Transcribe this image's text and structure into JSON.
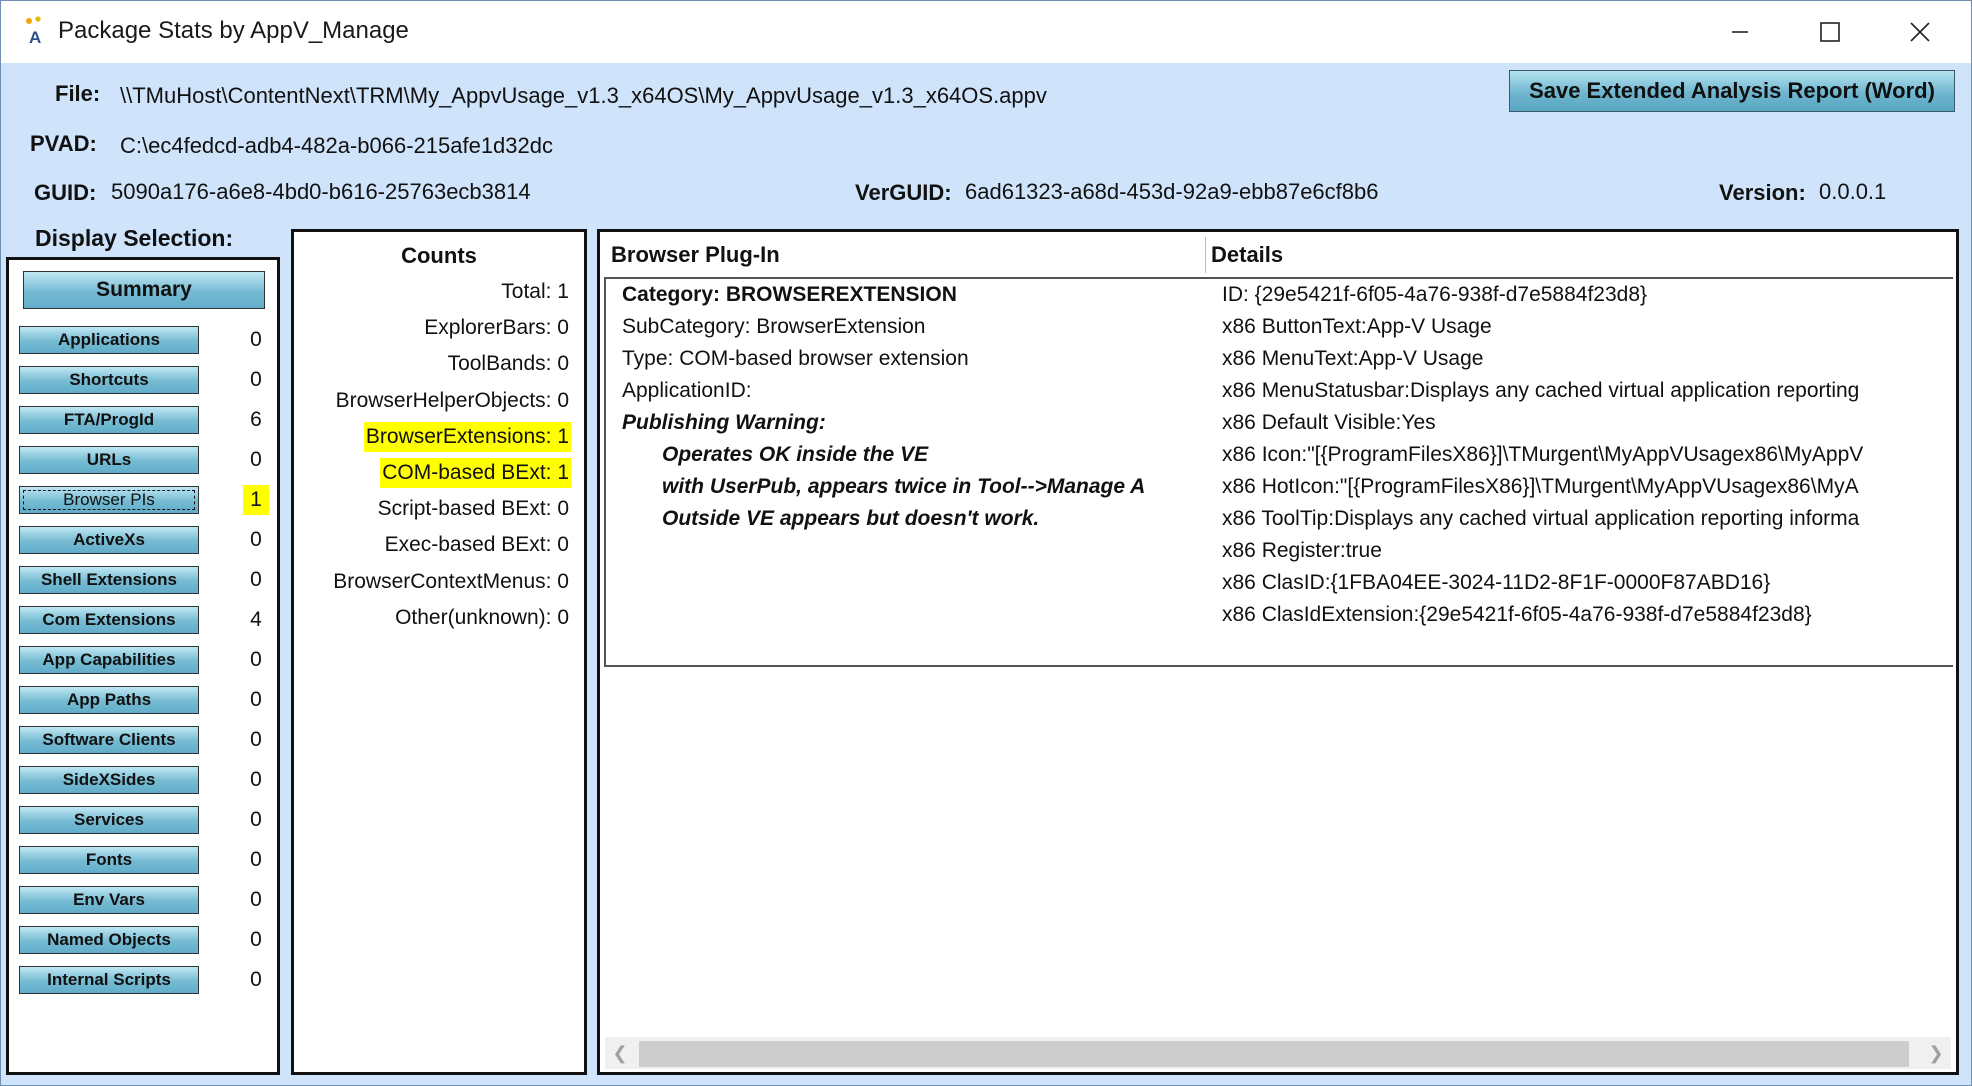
{
  "window": {
    "title": "Package Stats by AppV_Manage"
  },
  "header": {
    "file_label": "File:",
    "file_value": "\\\\TMuHost\\ContentNext\\TRM\\My_AppvUsage_v1.3_x64OS\\My_AppvUsage_v1.3_x64OS.appv",
    "pvad_label": "PVAD:",
    "pvad_value": "C:\\ec4fedcd-adb4-482a-b066-215afe1d32dc",
    "guid_label": "GUID:",
    "guid_value": "5090a176-a6e8-4bd0-b616-25763ecb3814",
    "verguid_label": "VerGUID:",
    "verguid_value": "6ad61323-a68d-453d-92a9-ebb87e6cf8b6",
    "version_label": "Version:",
    "version_value": "0.0.0.1",
    "save_button": "Save Extended Analysis Report (Word)"
  },
  "display_selection": {
    "label": "Display Selection:",
    "summary_button": "Summary",
    "items": [
      {
        "label": "Applications",
        "count": "0"
      },
      {
        "label": "Shortcuts",
        "count": "0"
      },
      {
        "label": "FTA/ProgId",
        "count": "6"
      },
      {
        "label": "URLs",
        "count": "0"
      },
      {
        "label": "Browser PIs",
        "count": "1",
        "selected": true
      },
      {
        "label": "ActiveXs",
        "count": "0"
      },
      {
        "label": "Shell Extensions",
        "count": "0"
      },
      {
        "label": "Com Extensions",
        "count": "4"
      },
      {
        "label": "App Capabilities",
        "count": "0"
      },
      {
        "label": "App Paths",
        "count": "0"
      },
      {
        "label": "Software Clients",
        "count": "0"
      },
      {
        "label": "SideXSides",
        "count": "0"
      },
      {
        "label": "Services",
        "count": "0"
      },
      {
        "label": "Fonts",
        "count": "0"
      },
      {
        "label": "Env Vars",
        "count": "0"
      },
      {
        "label": "Named Objects",
        "count": "0"
      },
      {
        "label": "Internal Scripts",
        "count": "0"
      }
    ]
  },
  "counts": {
    "title": "Counts",
    "rows": [
      {
        "text": "Total: 1"
      },
      {
        "text": "ExplorerBars: 0"
      },
      {
        "text": "ToolBands: 0"
      },
      {
        "text": "BrowserHelperObjects: 0"
      },
      {
        "text": "BrowserExtensions: 1",
        "highlight": true
      },
      {
        "text": "COM-based BExt: 1",
        "highlight": true
      },
      {
        "text": "Script-based BExt: 0"
      },
      {
        "text": "Exec-based BExt: 0"
      },
      {
        "text": "BrowserContextMenus: 0"
      },
      {
        "text": "Other(unknown): 0"
      }
    ]
  },
  "table": {
    "col1_header": "Browser Plug-In",
    "col2_header": "Details",
    "left_lines": [
      "Category: BROWSEREXTENSION",
      "SubCategory: BrowserExtension",
      "Type: COM-based browser extension",
      "ApplicationID:",
      "Publishing Warning:",
      "Operates OK inside the VE",
      "with UserPub, appears twice in Tool-->Manage A",
      "Outside VE appears but doesn't work."
    ],
    "right_lines": [
      "ID: {29e5421f-6f05-4a76-938f-d7e5884f23d8}",
      "x86 ButtonText:App-V Usage",
      "x86 MenuText:App-V Usage",
      "x86 MenuStatusbar:Displays any cached virtual application reporting",
      "x86 Default Visible:Yes",
      "x86 Icon:\"[{ProgramFilesX86}]\\TMurgent\\MyAppVUsagex86\\MyAppV",
      "x86 HotIcon:\"[{ProgramFilesX86}]\\TMurgent\\MyAppVUsagex86\\MyA",
      "x86 ToolTip:Displays any cached virtual application reporting informa",
      "x86 Register:true",
      "x86 ClasID:{1FBA04EE-3024-11D2-8F1F-0000F87ABD16}",
      "x86 ClasIdExtension:{29e5421f-6f05-4a76-938f-d7e5884f23d8}"
    ]
  }
}
